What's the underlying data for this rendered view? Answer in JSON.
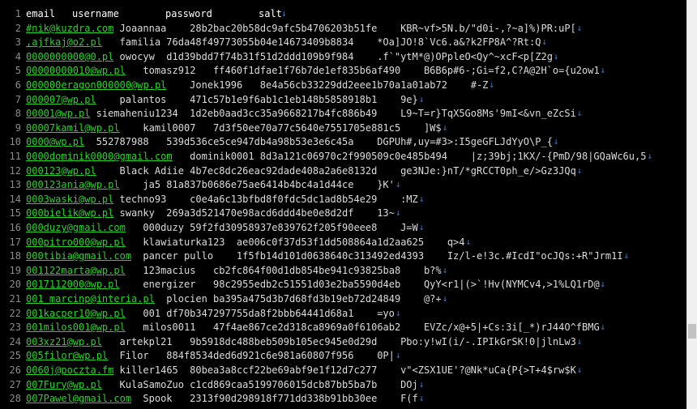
{
  "header": {
    "line": "1",
    "email": "email",
    "username": "username",
    "password": "password",
    "salt": "salt"
  },
  "rows": [
    {
      "line": "2",
      "email": "#nik@kuzdra.com",
      "username": "Joaannaa",
      "password": "28b2bac20b58dc9afc5b4706203b51fe",
      "salt": "KBR~vf>5N.b/\"d0i-,?~a]%)PR:uP["
    },
    {
      "line": "3",
      "email": ",ajfkaj@o2.pl",
      "username": "familia",
      "password": "76da48f49773055b04e14673409b8834",
      "salt": "*Oa]JO!8`Vc6.a&?k2FP8A^?Rt:Q"
    },
    {
      "line": "4",
      "email": "0000000000@0.pl",
      "username": "owocyw",
      "password": "d1d39bdd7f74b31f51d2ddd109b9f984",
      "salt": ".f`\"ytM*@)OPpleO<Qy^~xcF<p[Z2g"
    },
    {
      "line": "5",
      "email": "00000000010@wp.pl",
      "username": "tomasz912",
      "password": "ff460f1dfae1f76b7de1ef835b6af490",
      "salt": "B6B6p#6-;Gi=f2,C?A@2H`o={u2ow1"
    },
    {
      "line": "6",
      "email": "000000eragon000000@wp.pl",
      "username": "Jonek1996",
      "password": "8e4a56cb33229dd2eee1b70a1a01ab72",
      "salt": "#-Z"
    },
    {
      "line": "7",
      "email": "000007@wp.pl",
      "username": "palantos",
      "password": "471c57b1e9f6ab1c1eb148b5858918b1",
      "salt": "9e}"
    },
    {
      "line": "8",
      "email": "00001@wp.pl",
      "username": "siemaheniu1234",
      "password": "1d2eb0aad3cc35a9668217b4fc886b49",
      "salt": "L9~T=r}TqX5Go8Ms'9mI<&vn_eZcSi"
    },
    {
      "line": "9",
      "email": "00007kamil@wp.pl",
      "username": "kamil0007",
      "password": "7d3f50ee70a77c5640e7551705e881c5",
      "salt": "]W$"
    },
    {
      "line": "10",
      "email": "0000@wp.pl",
      "username": "552787988",
      "password": "539d536ce5ce947db4a98b53e3e6c45a",
      "salt": "DGPUh#,uy=#3>:I5geGFLJdYyO\\P_{"
    },
    {
      "line": "11",
      "email": "0000dominik0000@gmail.com",
      "username": "dominik0001",
      "password": "8d3a121c06970c2f990509c0e485b494",
      "salt": "|z;39bj;1KX/-{PmD/98|GQaWc6u,5"
    },
    {
      "line": "12",
      "email": "000123@wp.pl",
      "username": "Black Adiie",
      "password": "4b7ec8dc26eac92dade408a2a6e8132d",
      "salt": "ge3NJe:}nT/*gRCCT0ph_e/>Gz3JQq"
    },
    {
      "line": "13",
      "email": "000123ania@wp.pl",
      "username": "ja5",
      "password": "81a837b0686e75ae6414b4bc4a1d44ce",
      "salt": "}K'"
    },
    {
      "line": "14",
      "email": "0003waski@wp.pl",
      "username": "techno93",
      "password": "c0e4a6c13bfbd8f0fdc5dc1ad8b54e29",
      "salt": ":MZ"
    },
    {
      "line": "15",
      "email": "000bielik@wp.pl",
      "username": "swanky",
      "password": "269a3d521470e98acd6ddd4be0e8d2df",
      "salt": "13~"
    },
    {
      "line": "16",
      "email": "000duzy@gmail.com",
      "username": "000duzy",
      "password": "59f2fd30958937e839762f205f90eee8",
      "salt": "J=W"
    },
    {
      "line": "17",
      "email": "000pitro000@wp.pl",
      "username": "klawiaturka123",
      "password": "ae006c0f37d53f1dd508864a1d2aa625",
      "salt": "q>4"
    },
    {
      "line": "18",
      "email": "000tibia@gmail.com",
      "username": "pancer pullo",
      "password": "1f5fb14d101d0638640c313492ed4393",
      "salt": "Iz/l-e!3c.#IcdI\"ocJQs:+R\"Jrm1I"
    },
    {
      "line": "19",
      "email": "001122marta@wp.pl",
      "username": "123macius",
      "password": "cb2fc864f00d1db854be941c93825ba8",
      "salt": "b?%"
    },
    {
      "line": "20",
      "email": "0017112000@wp.pl",
      "username": "energizer",
      "password": "98c2955edb2c51551d03e2ba5590d4eb",
      "salt": "QyY<r1|(>`!Hv(NYMCv4,>1%LQ1rD@"
    },
    {
      "line": "21",
      "email": "001_marcinp@interia.pl",
      "username": "plocien",
      "password": "ba395a475d3b7d68fd3b19eb72d24849",
      "salt": "@?+"
    },
    {
      "line": "22",
      "email": "001kacper10@wp.pl",
      "username": "001",
      "password": "df70b347297755da8f2bbb64441d68a1",
      "salt": "=yo"
    },
    {
      "line": "23",
      "email": "001milos001@wp.pl",
      "username": "milos0011",
      "password": "47f4ae867ce2d318ca8969a0f6106ab2",
      "salt": "EVZc/x@+5|+Cs:3i[_*)rJ44O^fBMG"
    },
    {
      "line": "24",
      "email": "003xz21@wp.pl",
      "username": "artekpl21",
      "password": "9b5918dc488beb509b105ec945e0d29d",
      "salt": "Pbo:y!wI(i/-.IPIkGrSK!0|jlnLw3"
    },
    {
      "line": "25",
      "email": "005filor@wp.pl",
      "username": "Filor",
      "password": "884f8534ded6d921c6e981a60807f956",
      "salt": "0P|"
    },
    {
      "line": "26",
      "email": "0060j@poczta.fm",
      "username": "killer1465",
      "password": "80bea3a8ccf22be69abf9e1f12d7c277",
      "salt": "v\"<ZSX1UE'?@Nk*uCa{P{>T+4$rw$K"
    },
    {
      "line": "27",
      "email": "007Fury@wp.pl",
      "username": "KulaSamoZuo",
      "password": "c1cd869caa5199706015dcb87bb5ba7b",
      "salt": "DOj"
    },
    {
      "line": "28",
      "email": "007Pawel@gmail.com",
      "username": "Spook",
      "password": "2313f90d298918f771dd338b91bb30ee",
      "salt": "F(f"
    }
  ],
  "icons": {
    "tab_marker": "tab-arrow-icon"
  },
  "colors": {
    "background": "#000000",
    "email": "#2ad12a",
    "text": "#dcdcdc",
    "gutter": "#8c8c8c",
    "tab_arrow": "#3a7bd5"
  }
}
